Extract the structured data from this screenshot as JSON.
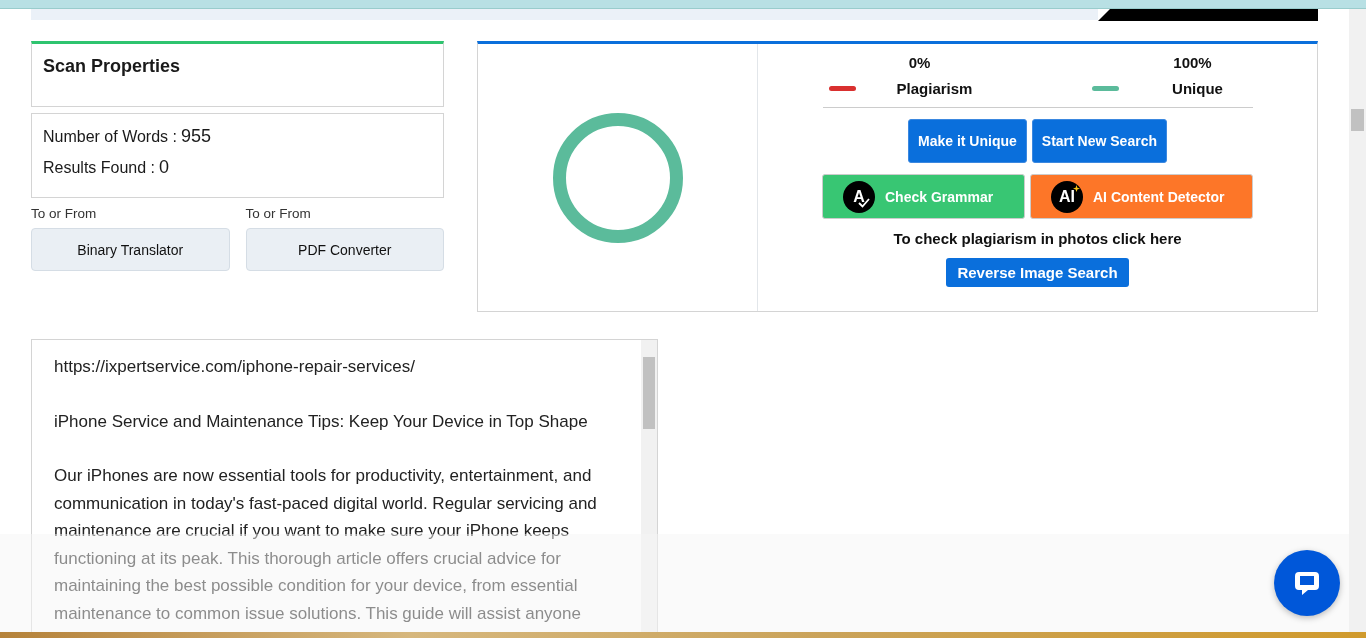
{
  "scan_properties": {
    "title": "Scan Properties",
    "stats": [
      {
        "label": "Number of Words :",
        "value": "955"
      },
      {
        "label": "Results Found :",
        "value": "0"
      }
    ],
    "tools": [
      {
        "caption": "To or From",
        "button": "Binary Translator"
      },
      {
        "caption": "To or From",
        "button": "PDF Converter"
      }
    ]
  },
  "result": {
    "legend": [
      {
        "percent": "0%",
        "label": "Plagiarism",
        "color": "#d9302f"
      },
      {
        "percent": "100%",
        "label": "Unique",
        "color": "#5bbb9b"
      }
    ],
    "actions": [
      "Make it Unique",
      "Start New Search"
    ],
    "tools": [
      {
        "kind": "grammar",
        "icon_text": "A",
        "label": "Check Grammar"
      },
      {
        "kind": "ai",
        "icon_text": "AI",
        "label": "AI Content Detector"
      }
    ],
    "photo_note": "To check plagiarism in photos click here",
    "reverse_button": "Reverse Image Search"
  },
  "text_input": {
    "paragraphs": [
      "https://ixpertservice.com/iphone-repair-services/",
      "iPhone Service and Maintenance Tips: Keep Your Device in Top Shape",
      "Our iPhones are now essential tools for productivity, entertainment, and communication in today's fast-paced digital world. Regular servicing and maintenance are crucial if you want to make sure your iPhone keeps functioning at its peak. This thorough article offers crucial advice for maintaining the best possible condition for your device, from essential maintenance to common issue solutions. This guide will assist anyone"
    ]
  }
}
